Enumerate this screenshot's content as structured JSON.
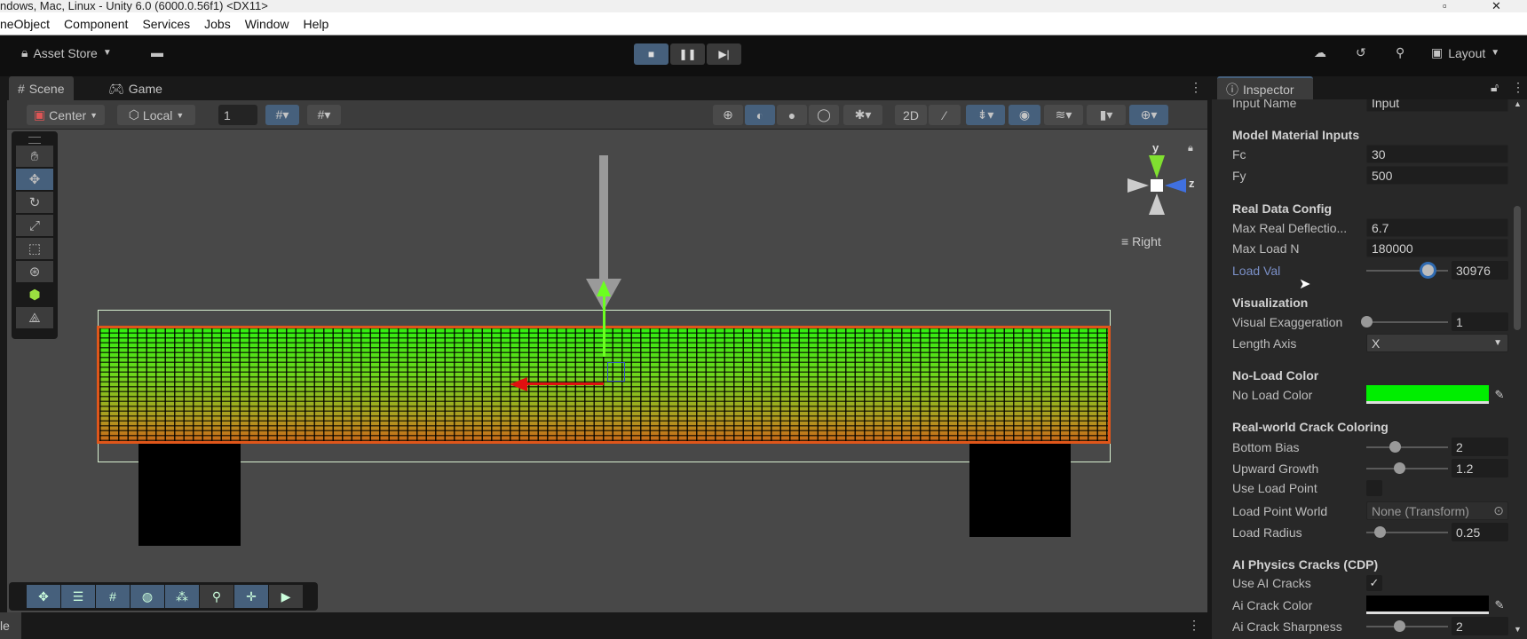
{
  "window": {
    "title": "ndows, Mac, Linux - Unity 6.0 (6000.0.56f1) <DX11>"
  },
  "menu": [
    "neObject",
    "Component",
    "Services",
    "Jobs",
    "Window",
    "Help"
  ],
  "toolbar": {
    "asset_store": "Asset Store",
    "layout": "Layout"
  },
  "tabs": {
    "scene": "Scene",
    "game": "Game",
    "inspector": "Inspector",
    "bottom_partial": "le"
  },
  "scene_toolbar": {
    "pivot": "Center",
    "space": "Local",
    "grid_value": "1"
  },
  "scene": {
    "view_label": "Right",
    "axis_y": "y",
    "axis_z": "z"
  },
  "inspector": {
    "input_name": {
      "label": "Input Name",
      "value": "Input"
    },
    "model_material": {
      "header": "Model Material Inputs",
      "fc_label": "Fc",
      "fc": "30",
      "fy_label": "Fy",
      "fy": "500"
    },
    "real_data": {
      "header": "Real Data Config",
      "max_defl_label": "Max Real Deflectio...",
      "max_defl": "6.7",
      "max_load_label": "Max Load N",
      "max_load": "180000",
      "load_val_label": "Load Val",
      "load_val": "30976",
      "load_val_fraction": 0.75
    },
    "visualization": {
      "header": "Visualization",
      "exag_label": "Visual Exaggeration",
      "exag": "1",
      "exag_fraction": 0.0,
      "axis_label": "Length Axis",
      "axis": "X"
    },
    "no_load": {
      "header": "No-Load Color",
      "label": "No Load Color",
      "color": "#00ee00"
    },
    "crack_coloring": {
      "header": "Real-world Crack Coloring",
      "bottom_bias_label": "Bottom Bias",
      "bottom_bias": "2",
      "bottom_bias_fraction": 0.35,
      "upward_label": "Upward Growth",
      "upward": "1.2",
      "upward_fraction": 0.4,
      "use_load_point_label": "Use Load Point",
      "use_load_point": false,
      "load_point_label": "Load Point World",
      "load_point": "None (Transform)",
      "load_radius_label": "Load Radius",
      "load_radius": "0.25",
      "load_radius_fraction": 0.16
    },
    "ai_cracks": {
      "header": "AI Physics Cracks (CDP)",
      "use_label": "Use AI Cracks",
      "use": true,
      "color_label": "Ai Crack Color",
      "color": "#000000",
      "sharpness_label": "Ai Crack Sharpness",
      "sharpness": "2",
      "sharpness_fraction": 0.4
    }
  }
}
